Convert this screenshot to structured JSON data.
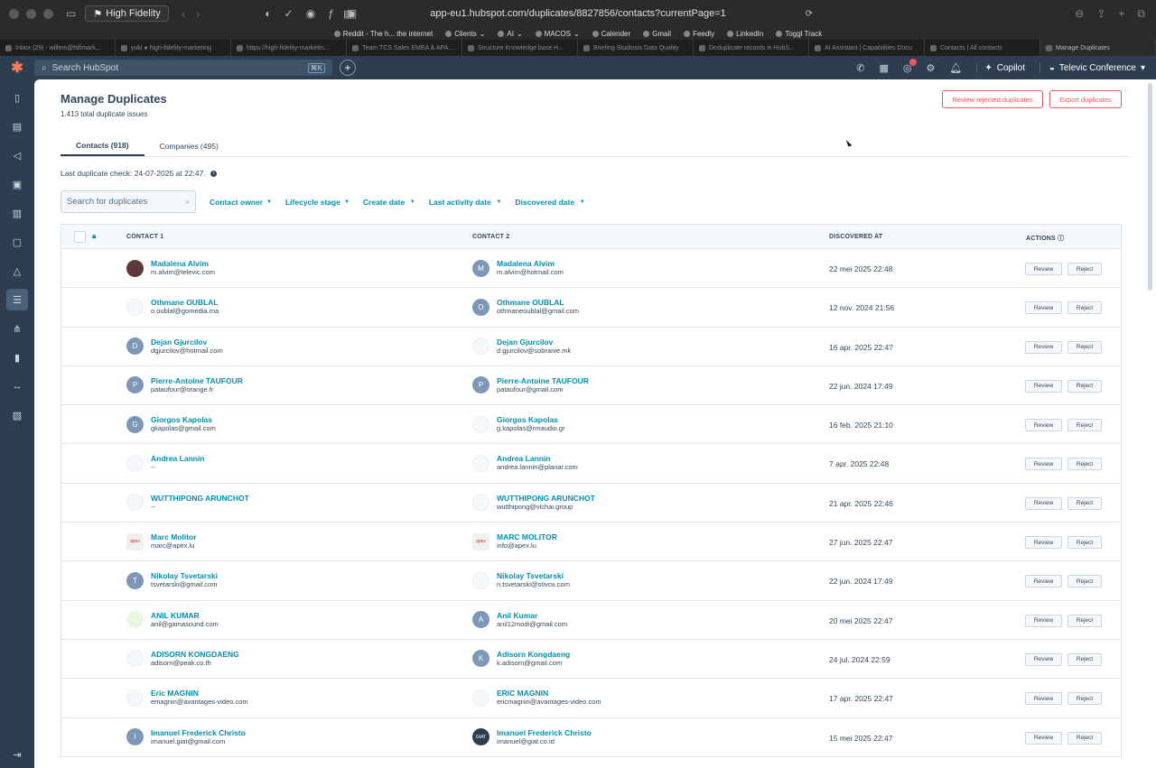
{
  "browser": {
    "profile": "High Fidelity",
    "url": "app-eu1.hubspot.com/duplicates/8827856/contacts?currentPage=1",
    "bookmarks": [
      "Reddit - The h... the internet",
      "Clients",
      "AI",
      "MACOS",
      "Calender",
      "Gmail",
      "Feedly",
      "LinkedIn",
      "Toggl Track"
    ],
    "tabs": [
      "Inbox (29) - willem@hifimark...",
      "yuki ● high-fidelity-marketing",
      "https://high-fidelity-marketin...",
      "Team TCS Sales EMEA & APA...",
      "Structure Knowledge base H...",
      "Briefing Studiosis Data Quality",
      "Deduplicate records in HubS...",
      "AI Assistant | Capabilities Docu",
      "Contacts | All contacts",
      "Manage Duplicates"
    ]
  },
  "topnav": {
    "search_placeholder": "Search HubSpot",
    "search_kbd": "⌘K",
    "copilot": "Copilot",
    "account": "Televic Conference"
  },
  "page": {
    "title": "Manage Duplicates",
    "subtitle": "1.413 total duplicate issues",
    "btn_review_rejected": "Review rejected duplicates",
    "btn_export": "Export duplicates",
    "tab_contacts": "Contacts (918)",
    "tab_companies": "Companies (495)",
    "last_check": "Last duplicate check: 24-07-2025 at 22:47.",
    "search_placeholder": "Search for duplicates",
    "filters": [
      "Contact owner",
      "Lifecycle stage",
      "Create date",
      "Last activity date",
      "Discovered date"
    ]
  },
  "table": {
    "headers": {
      "contact1": "CONTACT 1",
      "contact2": "CONTACT 2",
      "discovered": "DISCOVERED AT",
      "actions": "ACTIONS"
    },
    "review_label": "Review",
    "reject_label": "Reject",
    "rows": [
      {
        "c1_name": "Madalena Alvim",
        "c1_email": "m.alvim@televic.com",
        "c1_av": "",
        "c2_name": "Madalena Alvim",
        "c2_email": "m.alvim@hotmail.com",
        "c2_av": "M",
        "discovered": "22 mei 2025 22:48"
      },
      {
        "c1_name": "Othmane OUBLAL",
        "c1_email": "o.oublal@gomedia.ma",
        "c1_av": "",
        "c2_name": "Othmane OUBLAL",
        "c2_email": "othmaneoublal@gmail.com",
        "c2_av": "O",
        "discovered": "12 nov. 2024 21:56"
      },
      {
        "c1_name": "Dejan Gjurcilov",
        "c1_email": "dgjurcilov@hotmail.com",
        "c1_av": "D",
        "c2_name": "Dejan Gjurcilov",
        "c2_email": "d.gjurcilov@sobranie.mk",
        "c2_av": "",
        "discovered": "16 apr. 2025 22:47"
      },
      {
        "c1_name": "Pierre-Antoine TAUFOUR",
        "c1_email": "pataufour@orange.fr",
        "c1_av": "P",
        "c2_name": "Pierre-Antoine TAUFOUR",
        "c2_email": "pataufour@gmail.com",
        "c2_av": "P",
        "discovered": "22 jun. 2024 17:49"
      },
      {
        "c1_name": "Giorgos Kapolas",
        "c1_email": "gkapolas@gmail.com",
        "c1_av": "G",
        "c2_name": "Giorgos Kapolas",
        "c2_email": "g.kapolas@rmaudio.gr",
        "c2_av": "",
        "discovered": "16 feb. 2025 21:10"
      },
      {
        "c1_name": "Andrea Lannin",
        "c1_email": "--",
        "c1_av": "",
        "c2_name": "Andrea Lannin",
        "c2_email": "andrea.lannin@planar.com",
        "c2_av": "",
        "discovered": "7 apr. 2025 22:48"
      },
      {
        "c1_name": "WUTTHIPONG ARUNCHOT",
        "c1_email": "--",
        "c1_av": "",
        "c2_name": "WUTTHIPONG ARUNCHOT",
        "c2_email": "wutthipong@vichai.group",
        "c2_av": "",
        "discovered": "21 apr. 2025 22:46"
      },
      {
        "c1_name": "Marc Molitor",
        "c1_email": "marc@apex.lu",
        "c1_av": "apex",
        "c2_name": "MARC MOLITOR",
        "c2_email": "info@apex.lu",
        "c2_av": "apex",
        "discovered": "27 jun. 2025 22:47"
      },
      {
        "c1_name": "Nikolay Tsvetarski",
        "c1_email": "tsvetarski@gmail.com",
        "c1_av": "T",
        "c2_name": "Nikolay Tsvetarski",
        "c2_email": "n.tsvetarski@stivox.com",
        "c2_av": "",
        "discovered": "22 jun. 2024 17:49"
      },
      {
        "c1_name": "ANIL KUMAR",
        "c1_email": "anil@gamasound.com",
        "c1_av": "",
        "c2_name": "Anil Kumar",
        "c2_email": "anil12modi@gmail.com",
        "c2_av": "A",
        "discovered": "20 mei 2025 22:47"
      },
      {
        "c1_name": "ADISORN KONGDAENG",
        "c1_email": "adisorn@peak.co.th",
        "c1_av": "",
        "c2_name": "Adisorn Kongdaeng",
        "c2_email": "k.adisorn@gmail.com",
        "c2_av": "K",
        "discovered": "24 jul. 2024 22:59"
      },
      {
        "c1_name": "Eric MAGNIN",
        "c1_email": "emagnin@avantages-video.com",
        "c1_av": "",
        "c2_name": "ERIC MAGNIN",
        "c2_email": "ericmagnin@avantages-video.com",
        "c2_av": "",
        "discovered": "17 apr. 2025 22:47"
      },
      {
        "c1_name": "Imanuel Frederick Christo",
        "c1_email": "imanuel.giat@gmail.com",
        "c1_av": "I",
        "c2_name": "Imanuel Frederick Christo",
        "c2_email": "imanuel@giat.co.id",
        "c2_av": "GIAT",
        "discovered": "15 mei 2025 22:47"
      }
    ]
  },
  "colors": {
    "accent": "#0091ae",
    "danger": "#f2545b",
    "nav": "#2d3e50",
    "brand": "#ff7a59"
  }
}
